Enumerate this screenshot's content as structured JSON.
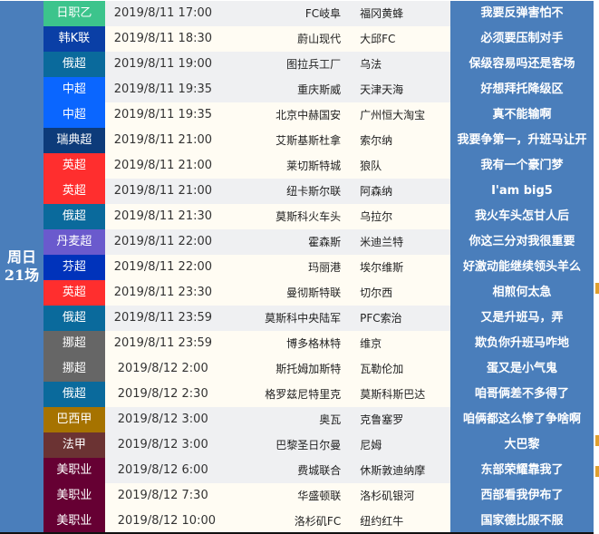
{
  "day": {
    "line1": "周日",
    "line2": "21场"
  },
  "colors": {
    "comment_bg": "#4a7ebb",
    "row_grey": "#eff0f2",
    "row_cream": "#fffcf3"
  },
  "matches": [
    {
      "league": "日职乙",
      "color": "#3cc48c",
      "time": "2019/8/11 17:00",
      "home": "FC岐阜",
      "away": "福冈黄蜂",
      "comment": "我要反弹害怕不",
      "bg": "grey"
    },
    {
      "league": "韩K联",
      "color": "#0a3fa6",
      "time": "2019/8/11 18:30",
      "home": "蔚山现代",
      "away": "大邱FC",
      "comment": "必须要压制对手",
      "bg": "cream"
    },
    {
      "league": "俄超",
      "color": "#0a6a9c",
      "time": "2019/8/11 19:00",
      "home": "图拉兵工厂",
      "away": "乌法",
      "comment": "保级容易吗还是客场",
      "bg": "grey"
    },
    {
      "league": "中超",
      "color": "#0a66ff",
      "time": "2019/8/11 19:35",
      "home": "重庆斯威",
      "away": "天津天海",
      "comment": "好想拜托降级区",
      "bg": "grey"
    },
    {
      "league": "中超",
      "color": "#0a66ff",
      "time": "2019/8/11 19:35",
      "home": "北京中赫国安",
      "away": "广州恒大淘宝",
      "comment": "真不能输啊",
      "bg": "cream"
    },
    {
      "league": "瑞典超",
      "color": "#0d3b7a",
      "time": "2019/8/11 21:00",
      "home": "艾斯基斯杜拿",
      "away": "索尔纳",
      "comment": "我要争第一，升班马让开",
      "bg": "cream"
    },
    {
      "league": "英超",
      "color": "#ff2e2e",
      "time": "2019/8/11 21:00",
      "home": "莱切斯特城",
      "away": "狼队",
      "comment": "我有一个豪门梦",
      "bg": "cream"
    },
    {
      "league": "英超",
      "color": "#ff2e2e",
      "time": "2019/8/11 21:00",
      "home": "纽卡斯尔联",
      "away": "阿森纳",
      "comment": "I'am big5",
      "bg": "grey"
    },
    {
      "league": "俄超",
      "color": "#0a6a9c",
      "time": "2019/8/11 21:30",
      "home": "莫斯科火车头",
      "away": "乌拉尔",
      "comment": "我火车头怎甘人后",
      "bg": "cream"
    },
    {
      "league": "丹麦超",
      "color": "#6a5acd",
      "time": "2019/8/11 22:00",
      "home": "霍森斯",
      "away": "米迪兰特",
      "comment": "你这三分对我很重要",
      "bg": "grey"
    },
    {
      "league": "芬超",
      "color": "#0033bb",
      "time": "2019/8/11 22:00",
      "home": "玛丽港",
      "away": "埃尔维斯",
      "comment": "好激动能继续领头羊么",
      "bg": "cream"
    },
    {
      "league": "英超",
      "color": "#ff2e2e",
      "time": "2019/8/11 23:30",
      "home": "曼彻斯特联",
      "away": "切尔西",
      "comment": "相煎何太急",
      "bg": "cream"
    },
    {
      "league": "俄超",
      "color": "#0a6a9c",
      "time": "2019/8/11 23:59",
      "home": "莫斯科中央陆军",
      "away": "PFC索治",
      "comment": "又是升班马，弄",
      "bg": "grey"
    },
    {
      "league": "挪超",
      "color": "#666666",
      "time": "2019/8/11 23:59",
      "home": "博多格林特",
      "away": "维京",
      "comment": "欺负你升班马咋地",
      "bg": "cream"
    },
    {
      "league": "挪超",
      "color": "#666666",
      "time": "2019/8/12 2:00",
      "home": "斯托姆加斯特",
      "away": "瓦勒伦加",
      "comment": "蛋又是小气鬼",
      "bg": "cream"
    },
    {
      "league": "俄超",
      "color": "#0a6a9c",
      "time": "2019/8/12 2:30",
      "home": "格罗兹尼特里克",
      "away": "莫斯科斯巴达",
      "comment": "咱哥俩差不多得了",
      "bg": "cream"
    },
    {
      "league": "巴西甲",
      "color": "#a67300",
      "time": "2019/8/12 3:00",
      "home": "奥瓦",
      "away": "克鲁塞罗",
      "comment": "咱俩都这么惨了争啥啊",
      "bg": "grey"
    },
    {
      "league": "法甲",
      "color": "#6b3333",
      "time": "2019/8/12 3:00",
      "home": "巴黎圣日尔曼",
      "away": "尼姆",
      "comment": "大巴黎",
      "bg": "grey"
    },
    {
      "league": "美职业",
      "color": "#660033",
      "time": "2019/8/12 6:00",
      "home": "费城联合",
      "away": "休斯敦迪纳摩",
      "comment": "东部荣耀靠我了",
      "bg": "grey"
    },
    {
      "league": "美职业",
      "color": "#660033",
      "time": "2019/8/12 7:30",
      "home": "华盛顿联",
      "away": "洛杉矶银河",
      "comment": "西部看我伊布了",
      "bg": "cream"
    },
    {
      "league": "美职业",
      "color": "#660033",
      "time": "2019/8/12 10:00",
      "home": "洛杉矶FC",
      "away": "纽约红牛",
      "comment": "国家德比服不服",
      "bg": "cream"
    }
  ]
}
